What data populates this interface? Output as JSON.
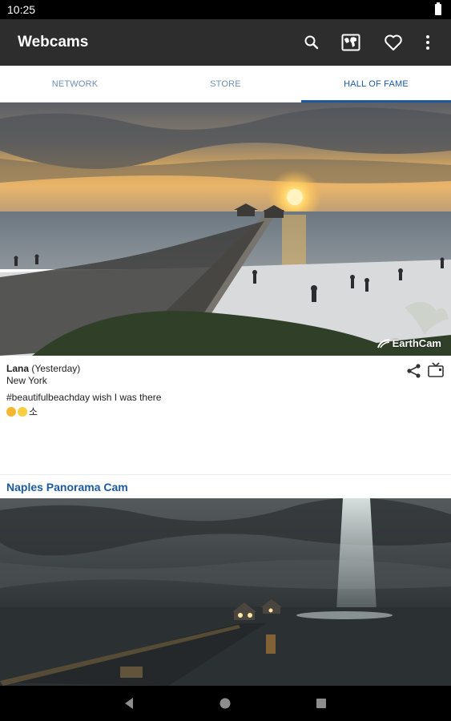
{
  "status_bar": {
    "time": "10:25"
  },
  "app_bar": {
    "title": "Webcams",
    "actions": [
      "search-icon",
      "map-icon",
      "heart-icon",
      "more-vert-icon"
    ]
  },
  "tabs": [
    {
      "label": "NETWORK",
      "active": false
    },
    {
      "label": "STORE",
      "active": false
    },
    {
      "label": "HALL OF FAME",
      "active": true
    }
  ],
  "post": {
    "image_brand": "EarthCam",
    "user": "Lana",
    "when": "(Yesterday)",
    "location": "New York",
    "message": "#beautifulbeachday wish I was there",
    "emoji_text": "소"
  },
  "camera": {
    "title": "Naples Panorama Cam"
  },
  "colors": {
    "accent": "#1c5aa0",
    "appbar": "#2d2d2d",
    "tab_inactive": "#6f8fb3"
  },
  "nav_bar": {
    "buttons": [
      "back-icon",
      "home-icon",
      "recents-icon"
    ]
  }
}
